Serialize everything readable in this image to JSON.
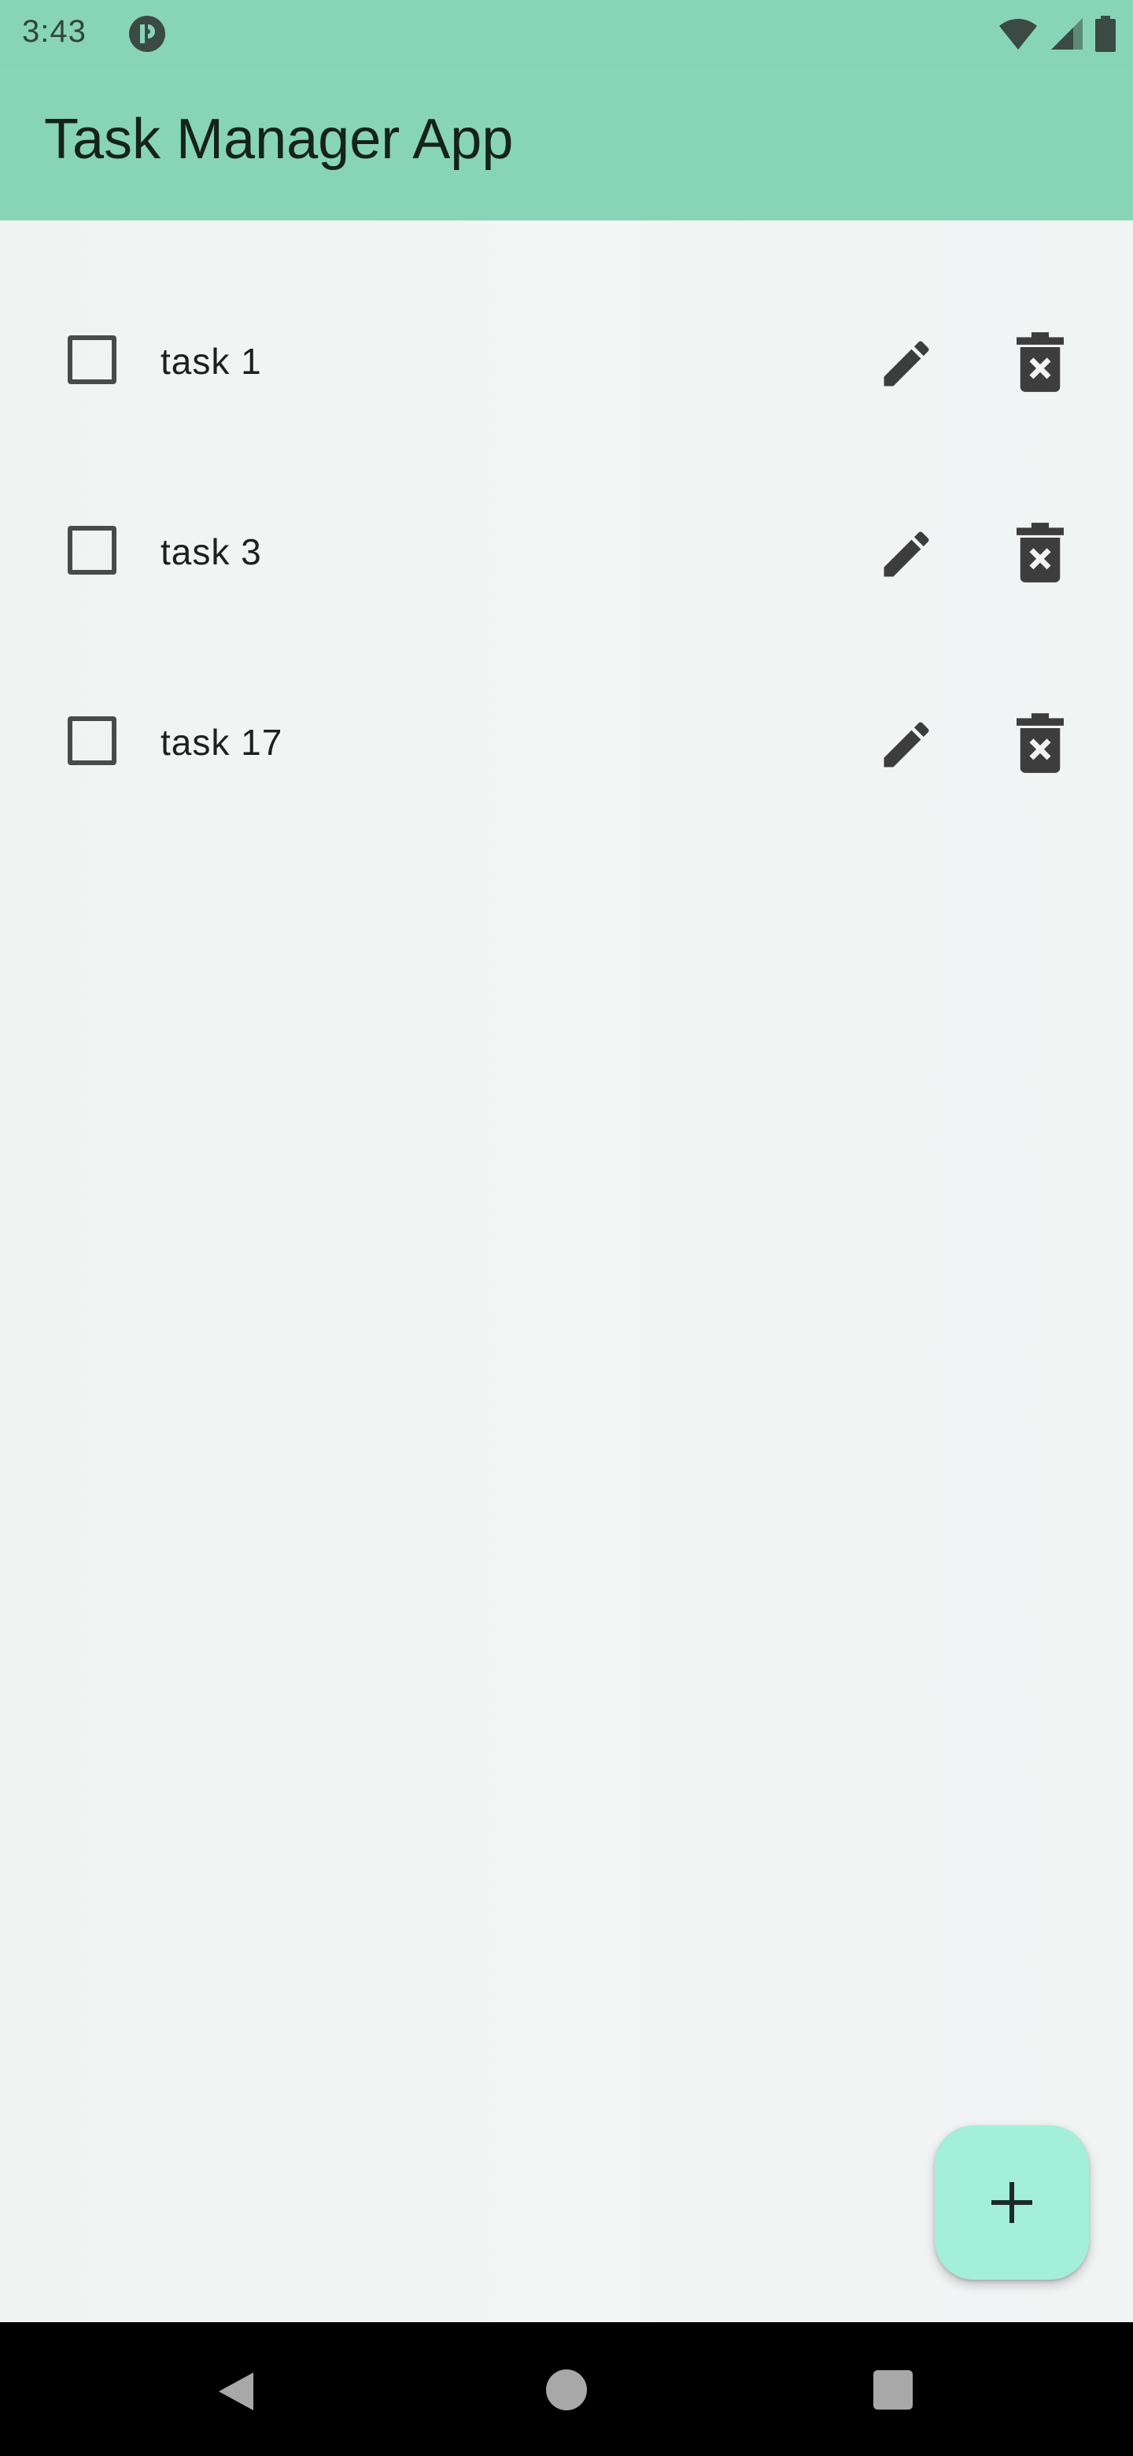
{
  "status_bar": {
    "time": "3:43",
    "icons": [
      "app-notification-icon",
      "wifi-icon",
      "signal-icon",
      "battery-icon"
    ]
  },
  "app_bar": {
    "title": "Task Manager App",
    "color": "#88d4b9"
  },
  "tasks": [
    {
      "label": "task 1",
      "checked": false
    },
    {
      "label": "task 3",
      "checked": false
    },
    {
      "label": "task 17",
      "checked": false
    }
  ],
  "fab": {
    "icon": "plus-icon",
    "color": "#a3efd8"
  },
  "nav_bar": {
    "icons": [
      "back-icon",
      "home-icon",
      "recents-icon"
    ]
  }
}
